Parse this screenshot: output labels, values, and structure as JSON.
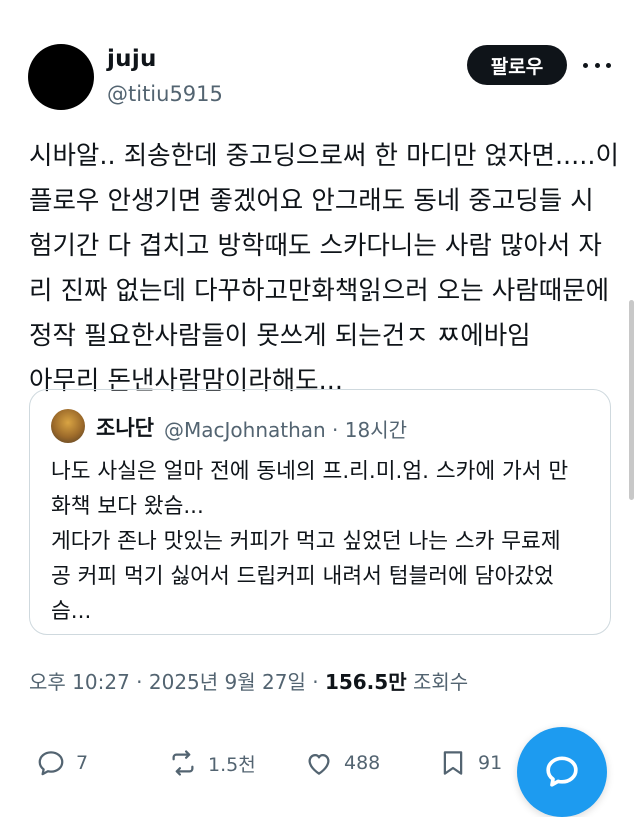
{
  "author": {
    "name": "juju",
    "handle": "@titiu5915"
  },
  "follow_label": "팔로우",
  "tweet_lines": [
    "시바알.. 죄송한데 중고딩으로써 한 마디만 얹자면.....이",
    "플로우 안생기면 좋겠어요 안그래도 동네 중고딩들 시",
    "험기간 다 겹치고 방학때도 스카다니는 사람 많아서 자",
    "리 진짜 없는데 다꾸하고만화책읽으러 오는 사람때문에",
    "정작 필요한사람들이 못쓰게 되는건ㅈ ㅉ에바임",
    "아무리 돈낸사람맘이라해도..."
  ],
  "quote": {
    "name": "조나단",
    "handle_time": "@MacJohnathan · 18시간",
    "lines": [
      "나도 사실은 얼마 전에 동네의 프.리.미.엄. 스카에 가서 만",
      "화책 보다 왔슴...",
      "게다가 존나 맛있는 커피가 먹고 싶었던 나는 스카 무료제",
      "공 커피 먹기 싫어서 드립커피 내려서 텀블러에 담아갔었",
      "슴..."
    ]
  },
  "meta": {
    "time": "오후 10:27 · 2025년 9월 27일 · ",
    "views": "156.5만",
    "views_label": " 조회수"
  },
  "actions": {
    "replies": "7",
    "reposts": "1.5천",
    "likes": "488",
    "bookmarks": "91"
  },
  "colors": {
    "accent": "#1d9bf0",
    "text": "#0f1419",
    "secondary": "#536471",
    "border": "#cfd9de"
  }
}
